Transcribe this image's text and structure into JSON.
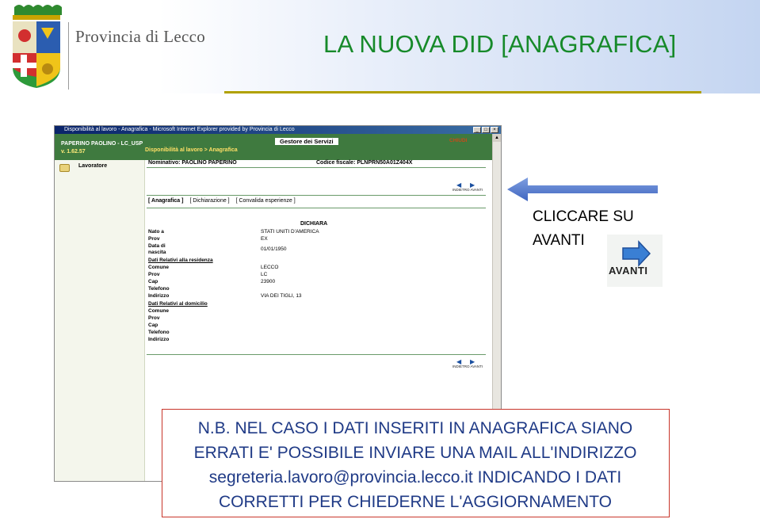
{
  "header": {
    "logo_text": "Provincia di Lecco",
    "title": "LA NUOVA DID [ANAGRAFICA]"
  },
  "browser": {
    "window_title": "Disponibilità al lavoro - Anagrafica - Microsoft Internet Explorer provided by Provincia di Lecco",
    "user": "PAPERINO PAOLINO - LC_USP",
    "version": "v. 1.62.57",
    "service": "Gestore dei Servizi",
    "close_label": "CHIUDI",
    "breadcrumb": "Disponibilità al lavoro > Anagrafica",
    "left_item": "Lavoratore",
    "nominativo": "Nominativo: PAOLINO  PAPERINO",
    "codice_fiscale": "Codice fiscale: PLNPRN50A01Z404X",
    "nav_back_label": "INDIETRO",
    "nav_next_label": "AVANTI",
    "tabs": [
      "[ Anagrafica ]",
      "[ Dichiarazione ]",
      "[ Convalida esperienze ]"
    ],
    "section_header": "DICHIARA",
    "fields": [
      {
        "label": "Nato a",
        "value": "STATI UNITI D'AMERICA"
      },
      {
        "label": "Prov",
        "value": "EX"
      },
      {
        "label": "Data di\nnascita",
        "value": "01/01/1950"
      }
    ],
    "residenza_section": "Dati Relativi alla residenza",
    "residenza_fields": [
      {
        "label": "Comune",
        "value": "LECCO"
      },
      {
        "label": "Prov",
        "value": "LC"
      },
      {
        "label": "Cap",
        "value": "23900"
      },
      {
        "label": "Telefono",
        "value": ""
      },
      {
        "label": "Indirizzo",
        "value": "VIA DEI TIGLI, 13"
      }
    ],
    "domicilio_section": "Dati Relativi al domicilio",
    "domicilio_fields": [
      {
        "label": "Comune",
        "value": ""
      },
      {
        "label": "Prov",
        "value": ""
      },
      {
        "label": "Cap",
        "value": ""
      },
      {
        "label": "Telefono",
        "value": ""
      },
      {
        "label": "Indirizzo",
        "value": ""
      }
    ]
  },
  "callout": {
    "line1": "CLICCARE SU",
    "line2": "AVANTI",
    "icon_label": "AVANTI"
  },
  "note": {
    "line1": "N.B. NEL CASO I DATI INSERITI IN ANAGRAFICA SIANO",
    "line2": "ERRATI E' POSSIBILE INVIARE UNA MAIL ALL'INDIRIZZO",
    "line3": "segreteria.lavoro@provincia.lecco.it INDICANDO I DATI",
    "line4": "CORRETTI PER CHIEDERNE L'AGGIORNAMENTO"
  },
  "colors": {
    "title": "#178a2a",
    "underline": "#b1a100",
    "app_header": "#3f7a3f",
    "note_text": "#1f3a86",
    "note_border": "#c8352a"
  }
}
